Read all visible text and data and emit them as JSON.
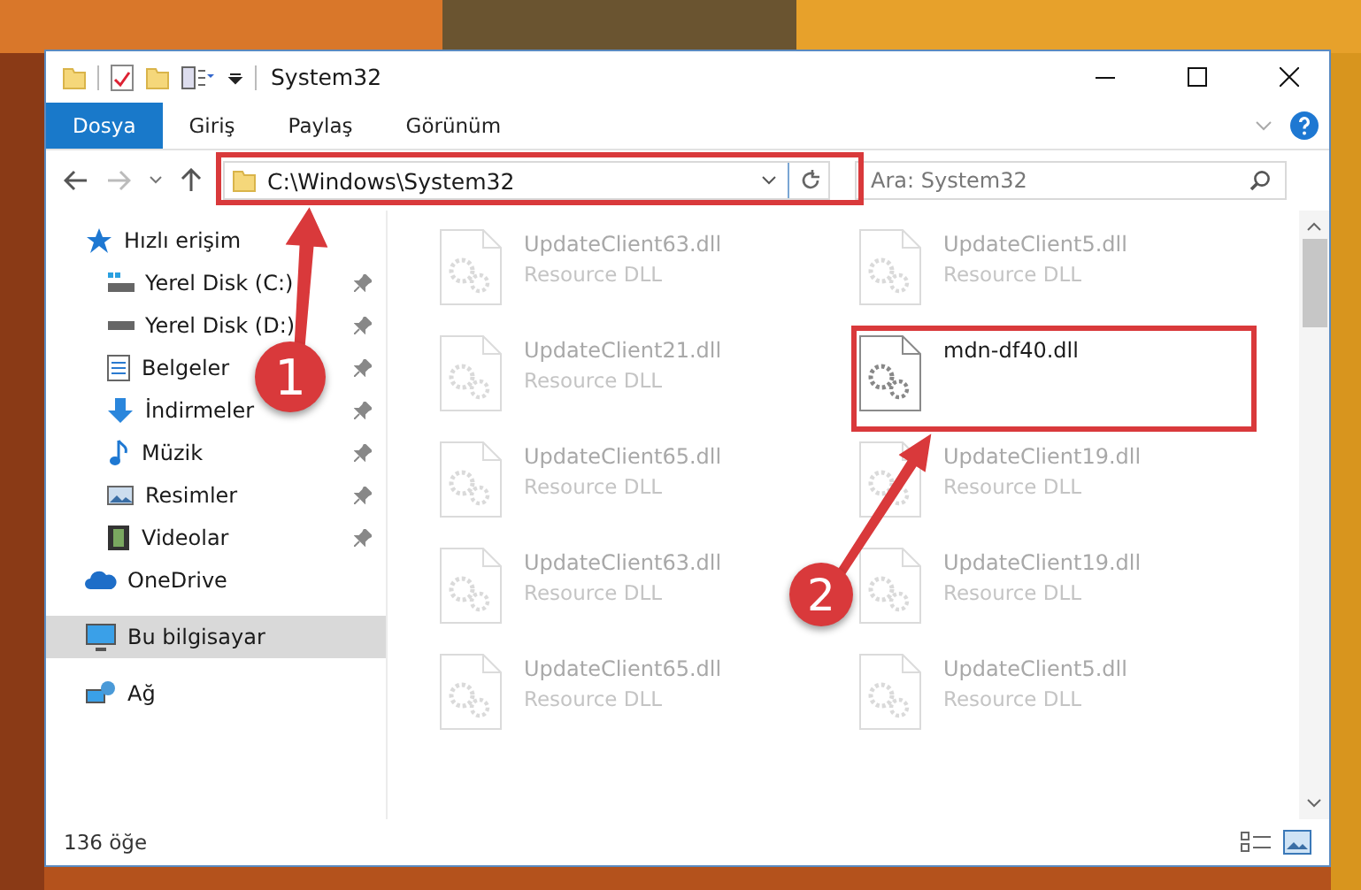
{
  "window": {
    "title": "System32"
  },
  "ribbon_tabs": [
    {
      "label": "Dosya",
      "selected": true
    },
    {
      "label": "Giriş",
      "selected": false
    },
    {
      "label": "Paylaş",
      "selected": false
    },
    {
      "label": "Görünüm",
      "selected": false
    }
  ],
  "address": {
    "path": "C:\\Windows\\System32"
  },
  "search": {
    "placeholder": "Ara: System32"
  },
  "sidebar": {
    "items": [
      {
        "label": "Hızlı erişim",
        "kind": "star",
        "selected": false,
        "children": [
          {
            "label": "Yerel Disk (C:)",
            "kind": "system-drive",
            "pinned": true,
            "selected": false
          },
          {
            "label": "Yerel Disk (D:)",
            "kind": "drive",
            "pinned": true,
            "selected": false
          },
          {
            "label": "Belgeler",
            "kind": "document",
            "pinned": true,
            "selected": false
          },
          {
            "label": "İndirmeler",
            "kind": "download",
            "pinned": true,
            "selected": false
          },
          {
            "label": "Müzik",
            "kind": "music",
            "pinned": true,
            "selected": false
          },
          {
            "label": "Resimler",
            "kind": "pictures",
            "pinned": true,
            "selected": false
          },
          {
            "label": "Videolar",
            "kind": "video",
            "pinned": true,
            "selected": false
          }
        ]
      },
      {
        "label": "OneDrive",
        "kind": "cloud",
        "selected": false
      },
      {
        "label": "Bu bilgisayar",
        "kind": "computer",
        "selected": true
      },
      {
        "label": "Ağ",
        "kind": "network",
        "selected": false
      }
    ]
  },
  "files": [
    {
      "name": "UpdateClient63.dll",
      "type": "Resource DLL",
      "blurred": true
    },
    {
      "name": "UpdateClient5.dll",
      "type": "Resource DLL",
      "blurred": true
    },
    {
      "name": "UpdateClient21.dll",
      "type": "Resource DLL",
      "blurred": true
    },
    {
      "name": "mdn-df40.dll",
      "blurred": false
    },
    {
      "name": "UpdateClient65.dll",
      "type": "Resource DLL",
      "blurred": true
    },
    {
      "name": "UpdateClient19.dll",
      "type": "Resource DLL",
      "blurred": true
    },
    {
      "name": "UpdateClient63.dll",
      "type": "Resource DLL",
      "blurred": true
    },
    {
      "name": "UpdateClient19.dll",
      "type": "Resource DLL",
      "blurred": true
    },
    {
      "name": "UpdateClient65.dll",
      "type": "Resource DLL",
      "blurred": true
    },
    {
      "name": "UpdateClient5.dll",
      "type": "Resource DLL",
      "blurred": true
    }
  ],
  "status_bar": {
    "item_count": "136 öğe"
  },
  "annotations": [
    {
      "number": "1"
    },
    {
      "number": "2"
    }
  ]
}
